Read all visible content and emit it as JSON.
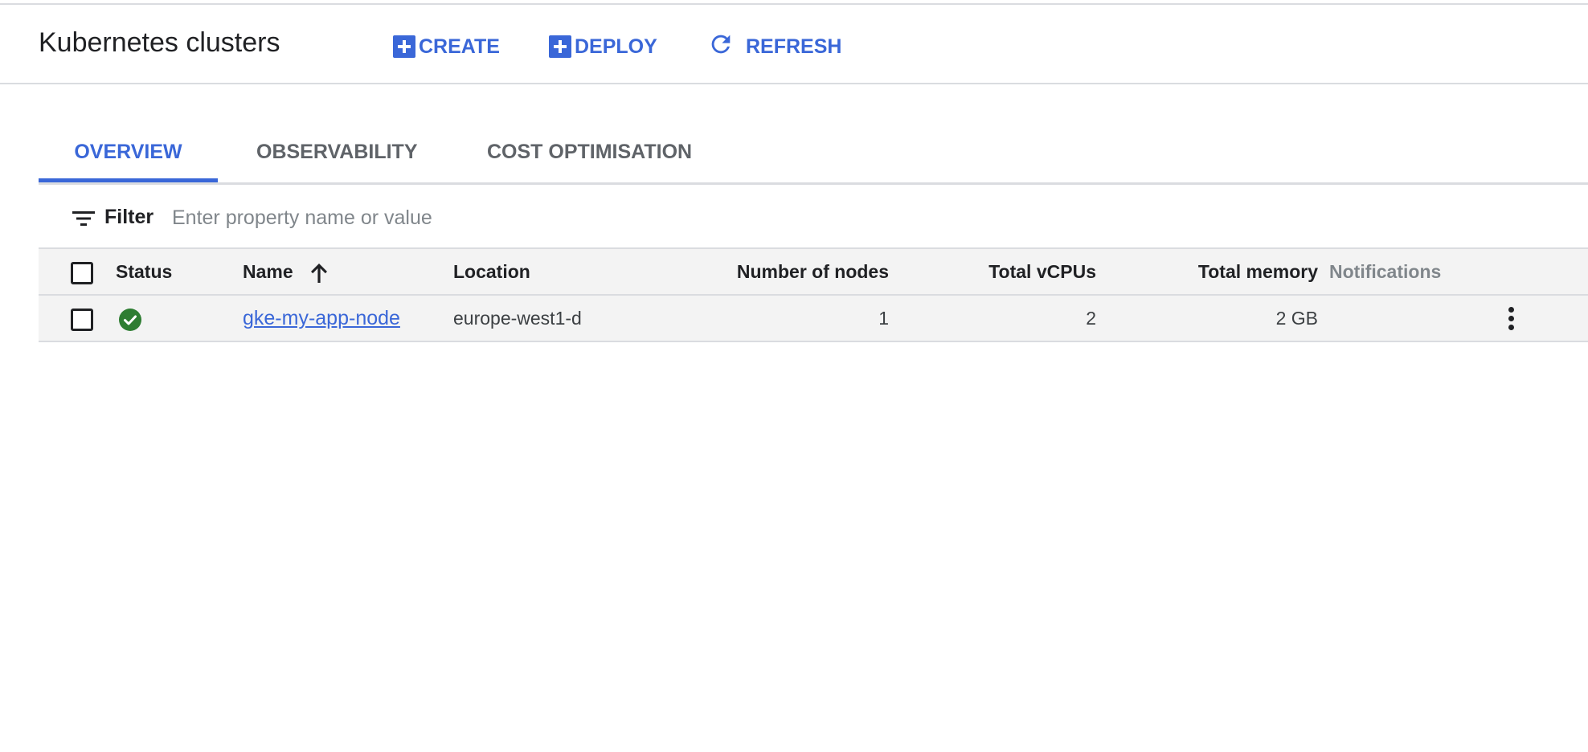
{
  "header": {
    "title": "Kubernetes clusters",
    "actions": {
      "create": "CREATE",
      "deploy": "DEPLOY",
      "refresh": "REFRESH"
    }
  },
  "tabs": [
    {
      "label": "OVERVIEW",
      "active": true
    },
    {
      "label": "OBSERVABILITY",
      "active": false
    },
    {
      "label": "COST OPTIMISATION",
      "active": false
    }
  ],
  "filter": {
    "label": "Filter",
    "placeholder": "Enter property name or value",
    "value": ""
  },
  "table": {
    "columns": {
      "status": "Status",
      "name": "Name",
      "location": "Location",
      "nodes": "Number of nodes",
      "vcpus": "Total vCPUs",
      "memory": "Total memory",
      "notifications": "Notifications"
    },
    "sort": {
      "column": "name",
      "direction": "ascending"
    },
    "rows": [
      {
        "status": "ok",
        "name": "gke-my-app-node",
        "location": "europe-west1-d",
        "nodes": "1",
        "vcpus": "2",
        "memory": "2 GB",
        "notifications": ""
      }
    ]
  },
  "colors": {
    "accent": "#3a67d8",
    "status_ok": "#2e7d32",
    "divider": "#dadce0"
  },
  "icons": {
    "create": "add-box-icon",
    "deploy": "add-box-icon",
    "refresh": "refresh-icon",
    "filter": "filter-list-icon",
    "sort": "arrow-up-icon",
    "status": "check-circle-icon",
    "row_menu": "more-vert-icon"
  }
}
